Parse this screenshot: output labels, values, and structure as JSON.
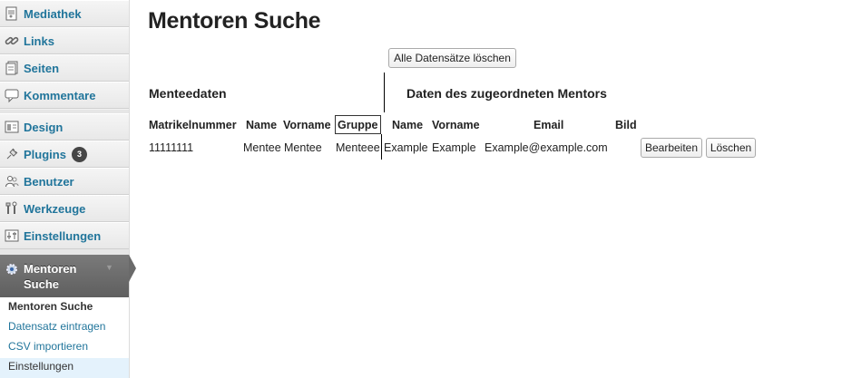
{
  "sidebar": {
    "items": [
      {
        "label": "Mediathek",
        "icon": "media-icon"
      },
      {
        "label": "Links",
        "icon": "link-icon"
      },
      {
        "label": "Seiten",
        "icon": "pages-icon"
      },
      {
        "label": "Kommentare",
        "icon": "comment-icon"
      },
      {
        "label": "Design",
        "icon": "appearance-icon"
      },
      {
        "label": "Plugins",
        "icon": "plugin-icon",
        "badge": "3"
      },
      {
        "label": "Benutzer",
        "icon": "users-icon"
      },
      {
        "label": "Werkzeuge",
        "icon": "tools-icon"
      },
      {
        "label": "Einstellungen",
        "icon": "settings-icon"
      }
    ],
    "active": {
      "label": "Mentoren Suche",
      "icon": "gear-icon"
    },
    "submenu": [
      {
        "label": "Mentoren Suche",
        "current": true
      },
      {
        "label": "Datensatz eintragen"
      },
      {
        "label": "CSV importieren"
      },
      {
        "label": "Einstellungen"
      }
    ]
  },
  "main": {
    "title": "Mentoren Suche",
    "delete_all_label": "Alle Datensätze löschen",
    "mentee_heading": "Menteedaten",
    "mentor_heading": "Daten des zugeordneten Mentors",
    "headers": [
      "Matrikelnummer",
      "Name",
      "Vorname",
      "Gruppe",
      "Name",
      "Vorname",
      "Email",
      "Bild"
    ],
    "row": {
      "matrikel": "11111111",
      "mentee_name": "Mentee",
      "mentee_vorname": "Mentee",
      "gruppe": "Menteee",
      "mentor_name": "Example",
      "mentor_vorname": "Example",
      "email": "Example@example.com",
      "edit_label": "Bearbeiten",
      "delete_label": "Löschen"
    }
  },
  "colors": {
    "link": "#21759b",
    "active_menu": "#6a6a6a"
  }
}
